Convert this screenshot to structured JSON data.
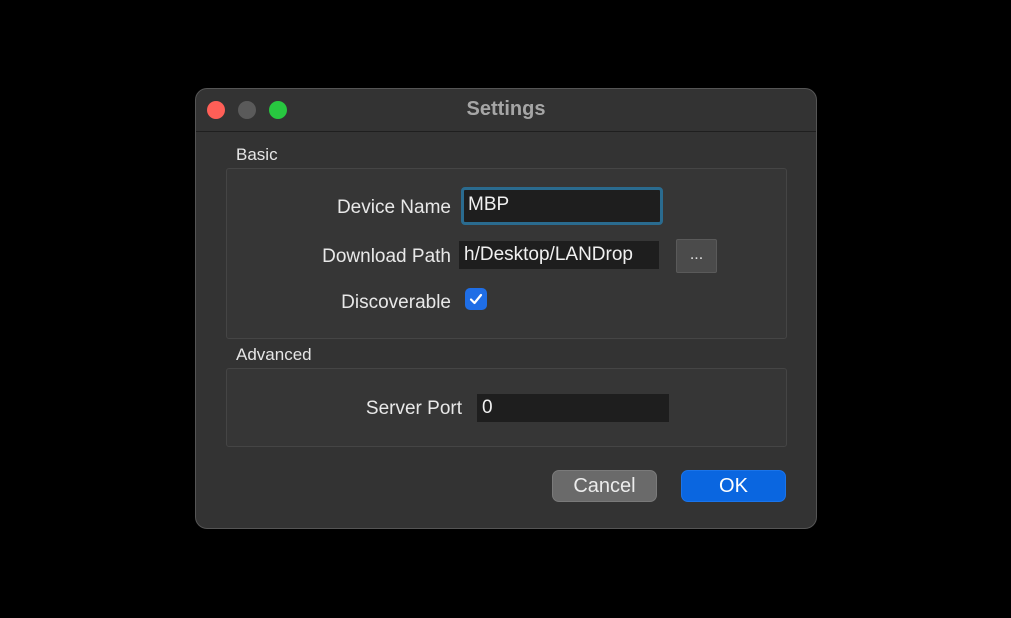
{
  "window": {
    "title": "Settings"
  },
  "basic": {
    "section_title": "Basic",
    "device_name_label": "Device Name",
    "device_name_value": "MBP",
    "download_path_label": "Download Path",
    "download_path_value": "h/Desktop/LANDrop",
    "browse_label": "...",
    "discoverable_label": "Discoverable",
    "discoverable_checked": true
  },
  "advanced": {
    "section_title": "Advanced",
    "server_port_label": "Server Port",
    "server_port_value": "0"
  },
  "buttons": {
    "cancel_label": "Cancel",
    "ok_label": "OK"
  },
  "colors": {
    "accent": "#0a66e0",
    "close": "#ff5f57",
    "zoom": "#28c840",
    "focus_ring": "#2a6b8f"
  }
}
